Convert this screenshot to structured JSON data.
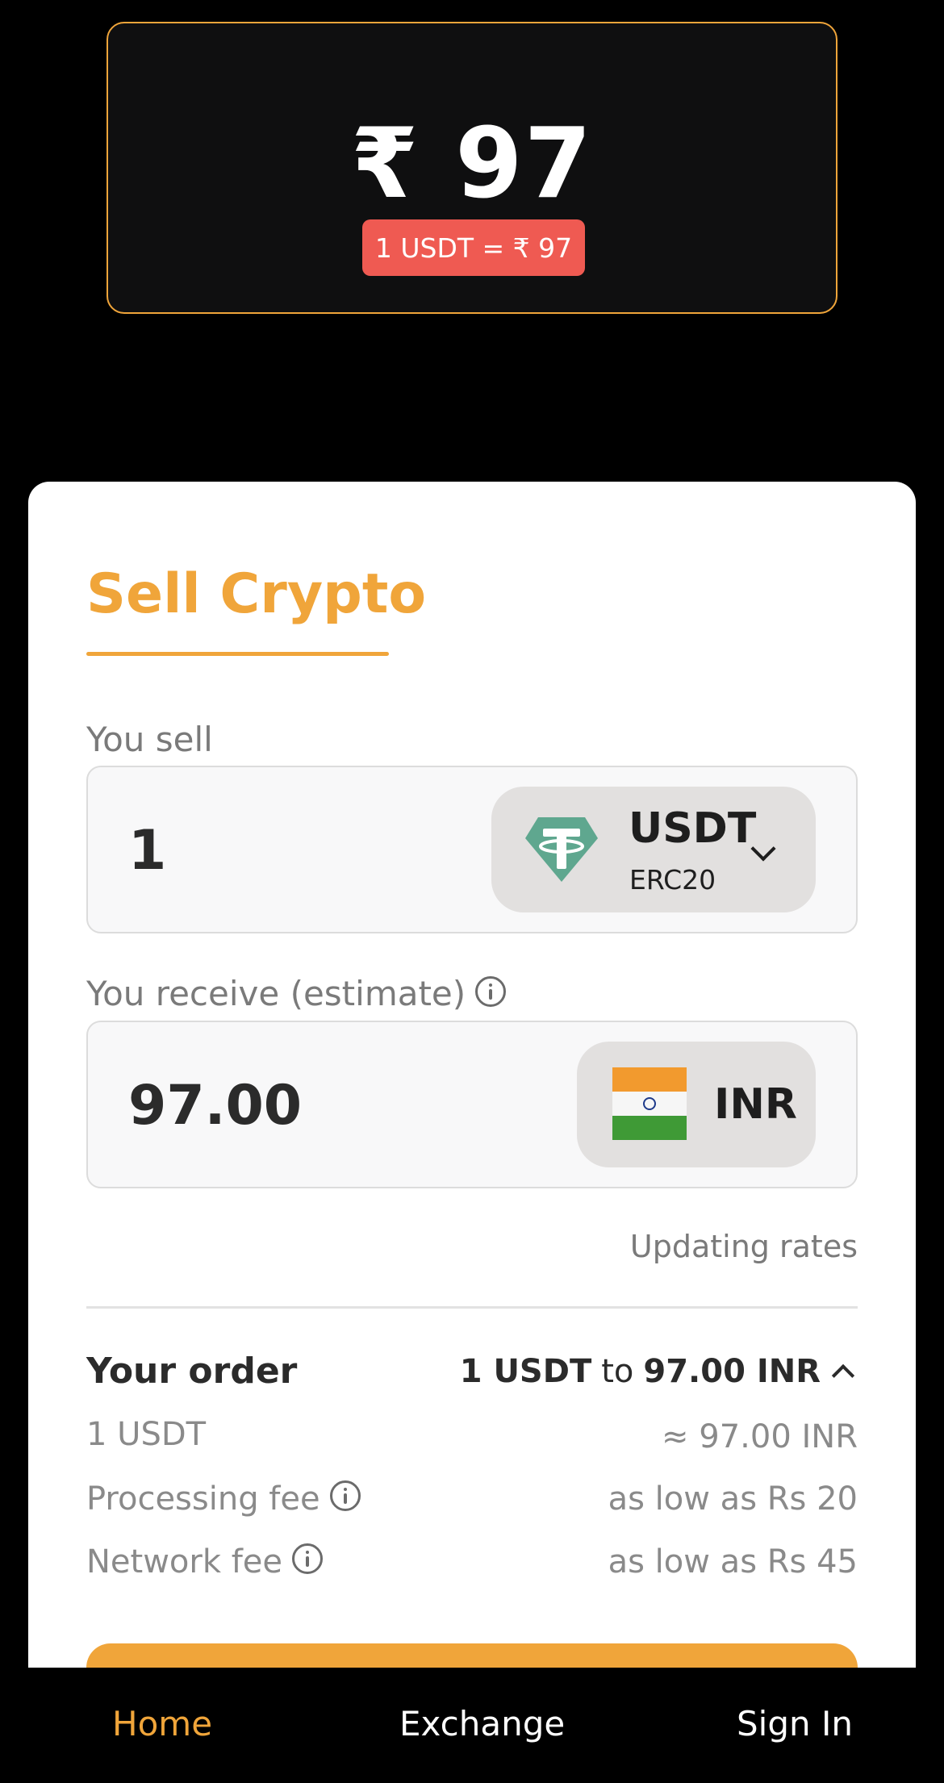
{
  "rate_card": {
    "big_rate": "₹ 97",
    "conversion_chip": "1 USDT = ₹ 97"
  },
  "form": {
    "title": "Sell Crypto",
    "sell_label": "You sell",
    "sell_amount": "1",
    "sell_asset": {
      "code": "USDT",
      "network": "ERC20",
      "icon": "tether-icon"
    },
    "receive_label": "You receive (estimate)",
    "receive_amount": "97.00",
    "receive_asset": {
      "code": "INR",
      "icon": "india-flag-icon"
    },
    "updating_text": "Updating rates"
  },
  "order": {
    "title": "Your order",
    "summary_from": "1 USDT",
    "summary_to_word": "to",
    "summary_to": "97.00 INR",
    "rows": [
      {
        "label": "1 USDT",
        "value": "≈ 97.00 INR"
      },
      {
        "label": "Processing fee",
        "value": "as low as Rs 20"
      },
      {
        "label": "Network fee",
        "value": "as low as Rs 45"
      }
    ]
  },
  "nav": {
    "items": [
      {
        "label": "Home",
        "active": true
      },
      {
        "label": "Exchange",
        "active": false
      },
      {
        "label": "Sign In",
        "active": false
      }
    ]
  },
  "colors": {
    "accent": "#f0a53a",
    "chip_red": "#ef5a52",
    "background": "#000000",
    "panel": "#ffffff",
    "tether_green": "#5fa78f"
  }
}
